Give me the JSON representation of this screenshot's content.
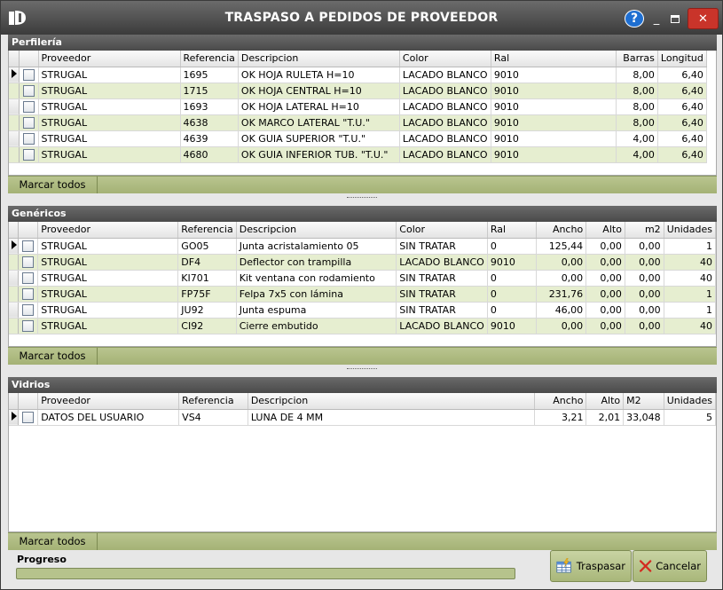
{
  "window": {
    "title": "TRASPASO A PEDIDOS DE PROVEEDOR",
    "help_label": "?",
    "minimize_label": "_",
    "close_label": "✕"
  },
  "perfileria": {
    "title": "Perfilería",
    "columns": [
      "Proveedor",
      "Referencia",
      "Descripcion",
      "Color",
      "Ral",
      "Barras",
      "Longitud"
    ],
    "rows": [
      [
        "STRUGAL",
        "1695",
        "OK HOJA RULETA H=10",
        "LACADO BLANCO",
        "9010",
        "8,00",
        "6,40"
      ],
      [
        "STRUGAL",
        "1715",
        "OK HOJA CENTRAL H=10",
        "LACADO BLANCO",
        "9010",
        "8,00",
        "6,40"
      ],
      [
        "STRUGAL",
        "1693",
        "OK HOJA LATERAL H=10",
        "LACADO BLANCO",
        "9010",
        "8,00",
        "6,40"
      ],
      [
        "STRUGAL",
        "4638",
        "OK MARCO LATERAL \"T.U.\"",
        "LACADO BLANCO",
        "9010",
        "8,00",
        "6,40"
      ],
      [
        "STRUGAL",
        "4639",
        "OK GUIA SUPERIOR \"T.U.\"",
        "LACADO BLANCO",
        "9010",
        "4,00",
        "6,40"
      ],
      [
        "STRUGAL",
        "4680",
        "OK GUIA INFERIOR TUB. \"T.U.\"",
        "LACADO BLANCO",
        "9010",
        "4,00",
        "6,40"
      ]
    ],
    "mark_all": "Marcar todos"
  },
  "genericos": {
    "title": "Genéricos",
    "columns": [
      "Proveedor",
      "Referencia",
      "Descripcion",
      "Color",
      "Ral",
      "Ancho",
      "Alto",
      "m2",
      "Unidades"
    ],
    "rows": [
      [
        "STRUGAL",
        "GO05",
        "Junta acristalamiento 05",
        "SIN TRATAR",
        "0",
        "125,44",
        "0,00",
        "0,00",
        "1"
      ],
      [
        "STRUGAL",
        "DF4",
        "Deflector con trampilla",
        "LACADO BLANCO",
        "9010",
        "0,00",
        "0,00",
        "0,00",
        "40"
      ],
      [
        "STRUGAL",
        "KI701",
        "Kit ventana con rodamiento",
        "SIN TRATAR",
        "0",
        "0,00",
        "0,00",
        "0,00",
        "40"
      ],
      [
        "STRUGAL",
        "FP75F",
        "Felpa 7x5 con lámina",
        "SIN TRATAR",
        "0",
        "231,76",
        "0,00",
        "0,00",
        "1"
      ],
      [
        "STRUGAL",
        "JU92",
        "Junta espuma",
        "SIN TRATAR",
        "0",
        "46,00",
        "0,00",
        "0,00",
        "1"
      ],
      [
        "STRUGAL",
        "CI92",
        "Cierre embutido",
        "LACADO BLANCO",
        "9010",
        "0,00",
        "0,00",
        "0,00",
        "40"
      ]
    ],
    "mark_all": "Marcar todos"
  },
  "vidrios": {
    "title": "Vidrios",
    "columns": [
      "Proveedor",
      "Referencia",
      "Descripcion",
      "Ancho",
      "Alto",
      "M2",
      "Unidades"
    ],
    "rows": [
      [
        "DATOS DEL USUARIO",
        "VS4",
        "LUNA DE 4 MM",
        "3,21",
        "2,01",
        "33,048",
        "5"
      ]
    ],
    "mark_all": "Marcar todos"
  },
  "footer": {
    "progress_label": "Progreso",
    "progress_value": 0.0,
    "traspasar": "Traspasar",
    "cancelar": "Cancelar"
  },
  "colors": {
    "row_alt": "#e6eed0",
    "bar_green": "#a9b77a",
    "title_bar": "#4a4a4a",
    "close_red": "#c9342a"
  },
  "icons": {
    "app": "app-logo-icon",
    "help": "help-icon",
    "transfer": "transfer-table-icon",
    "cancel": "cancel-x-icon",
    "row_pointer": "row-pointer-icon"
  }
}
